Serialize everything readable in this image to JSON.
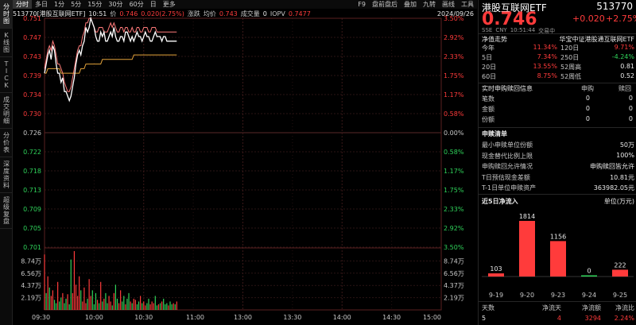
{
  "vtabs": [
    "分时图",
    "K线图",
    "TICK",
    "成交明细",
    "分价表",
    "深度资料",
    "超级复盘"
  ],
  "toolbar": {
    "left": [
      "分时",
      "多日",
      "1分",
      "5分",
      "15分",
      "30分",
      "60分",
      "日",
      "更多"
    ],
    "right": [
      "F9",
      "盘前盘后",
      "叠加",
      "九转",
      "画线",
      "工具"
    ]
  },
  "info": {
    "code_name": "513770[港股互联网ETF]",
    "time": "10:51",
    "price_label": "价",
    "price": "0.746",
    "chg_label": "涨跌",
    "chg": "0.020(2.75%)",
    "avg_label": "均价",
    "avg": "0.743",
    "vol_label": "成交量",
    "vol": "0",
    "iopv_label": "IOPV",
    "iopv": "0.7477",
    "date": "2024/09/26"
  },
  "chart_data": {
    "type": "line",
    "price_axis": [
      "0.751",
      "0.747",
      "0.743",
      "0.739",
      "0.734",
      "0.730",
      "0.726",
      "0.722",
      "0.718",
      "0.713",
      "0.709",
      "0.705",
      "0.701"
    ],
    "pct_axis": [
      "3.50%",
      "2.92%",
      "2.33%",
      "1.75%",
      "1.17%",
      "0.58%",
      "0.00%",
      "0.58%",
      "1.17%",
      "1.75%",
      "2.33%",
      "2.92%",
      "3.50%"
    ],
    "ylim": [
      0.701,
      0.751
    ],
    "prev_close": 0.726,
    "vol_axis": [
      "8.74万",
      "6.56万",
      "4.37万",
      "2.19万"
    ],
    "vol_axis_values": [
      87400,
      65600,
      43700,
      21900
    ],
    "vol_max": 109300,
    "time_axis": [
      "09:30",
      "10:00",
      "10:30",
      "11:00",
      "13:00",
      "13:30",
      "14:00",
      "14:30",
      "15:00"
    ],
    "price_series": [
      0.739,
      0.741,
      0.743,
      0.744,
      0.742,
      0.745,
      0.744,
      0.741,
      0.739,
      0.739,
      0.737,
      0.738,
      0.735,
      0.735,
      0.734,
      0.733,
      0.734,
      0.736,
      0.738,
      0.741,
      0.743,
      0.744,
      0.743,
      0.745,
      0.746,
      0.749,
      0.748,
      0.749,
      0.751,
      0.75,
      0.749,
      0.747,
      0.746,
      0.746,
      0.748,
      0.747,
      0.748,
      0.746,
      0.746,
      0.747,
      0.748,
      0.747,
      0.749,
      0.747,
      0.746,
      0.746,
      0.747,
      0.747,
      0.746,
      0.748,
      0.748,
      0.747,
      0.746,
      0.747,
      0.746,
      0.747,
      0.748,
      0.747,
      0.747,
      0.746,
      0.747,
      0.748,
      0.747,
      0.747,
      0.746,
      0.746,
      0.747,
      0.748,
      0.747,
      0.747,
      0.747,
      0.746,
      0.747,
      0.747,
      0.746,
      0.746,
      0.746,
      0.746,
      0.746,
      0.746,
      0.746
    ],
    "iopv_series": [
      0.74,
      0.742,
      0.744,
      0.745,
      0.744,
      0.746,
      0.745,
      0.743,
      0.741,
      0.741,
      0.74,
      0.739,
      0.737,
      0.736,
      0.735,
      0.735,
      0.736,
      0.738,
      0.74,
      0.742,
      0.744,
      0.745,
      0.745,
      0.747,
      0.748,
      0.75,
      0.75,
      0.751,
      0.751,
      0.75,
      0.749,
      0.748,
      0.748,
      0.749,
      0.749,
      0.749,
      0.748,
      0.748,
      0.748,
      0.749,
      0.75,
      0.749,
      0.75,
      0.749,
      0.748,
      0.748,
      0.749,
      0.749,
      0.748,
      0.749,
      0.749,
      0.748,
      0.748,
      0.749,
      0.748,
      0.748,
      0.749,
      0.749,
      0.748,
      0.748,
      0.749,
      0.749,
      0.749,
      0.748,
      0.748,
      0.749,
      0.749,
      0.749,
      0.748,
      0.748,
      0.748,
      0.748,
      0.748,
      0.748,
      0.748,
      0.748,
      0.748,
      0.748,
      0.748,
      0.748,
      0.748
    ],
    "avg_series": [
      0.739,
      0.739,
      0.74,
      0.74,
      0.74,
      0.74,
      0.74,
      0.74,
      0.74,
      0.74,
      0.739,
      0.739,
      0.739,
      0.739,
      0.739,
      0.739,
      0.739,
      0.739,
      0.739,
      0.739,
      0.739,
      0.739,
      0.74,
      0.74,
      0.74,
      0.741,
      0.741,
      0.741,
      0.741,
      0.741,
      0.741,
      0.741,
      0.741,
      0.741,
      0.741,
      0.742,
      0.742,
      0.742,
      0.742,
      0.742,
      0.742,
      0.742,
      0.742,
      0.742,
      0.742,
      0.742,
      0.742,
      0.742,
      0.742,
      0.742,
      0.742,
      0.742,
      0.742,
      0.742,
      0.743,
      0.743,
      0.743,
      0.743,
      0.743,
      0.743,
      0.743,
      0.743,
      0.743,
      0.743,
      0.743,
      0.743,
      0.743,
      0.743,
      0.743,
      0.743,
      0.743,
      0.743,
      0.743,
      0.743,
      0.743,
      0.743,
      0.743,
      0.743,
      0.743,
      0.743,
      0.743
    ],
    "volume": [
      99000,
      30000,
      60000,
      40000,
      25000,
      35000,
      18000,
      12000,
      50000,
      15000,
      22000,
      30000,
      12000,
      20000,
      28000,
      10000,
      90000,
      30000,
      105000,
      45000,
      25000,
      60000,
      35000,
      15000,
      40000,
      12000,
      20000,
      55000,
      25000,
      35000,
      10000,
      30000,
      18000,
      12000,
      50000,
      15000,
      20000,
      30000,
      12000,
      25000,
      15000,
      8000,
      30000,
      45000,
      20000,
      12000,
      35000,
      15000,
      25000,
      10000,
      20000,
      30000,
      15000,
      12000,
      20000,
      18000,
      10000,
      15000,
      25000,
      12000,
      15000,
      8000,
      12000,
      20000,
      10000,
      15000,
      12000,
      25000,
      8000,
      10000,
      12000,
      15000,
      20000,
      10000,
      12000,
      8000,
      15000,
      10000,
      12000,
      10000,
      15000
    ],
    "volume_up": [
      true,
      false,
      true,
      false,
      true,
      true,
      false,
      false,
      true,
      false,
      false,
      true,
      false,
      false,
      true,
      false,
      false,
      true,
      true,
      true,
      true,
      true,
      false,
      true,
      true,
      true,
      false,
      true,
      true,
      false,
      false,
      false,
      true,
      false,
      true,
      false,
      true,
      false,
      false,
      true,
      true,
      false,
      true,
      false,
      false,
      true,
      true,
      false,
      false,
      true,
      false,
      false,
      true,
      false,
      true,
      true,
      false,
      false,
      true,
      false,
      true,
      true,
      false,
      false,
      true,
      true,
      true,
      false,
      false,
      true,
      false,
      true,
      false,
      false,
      false,
      true,
      false,
      false,
      true,
      false,
      true
    ]
  },
  "panel": {
    "title": "港股互联网ETF",
    "code": "513770",
    "price": "0.746",
    "change": "+0.020",
    "change_pct": "+2.75%",
    "meta": [
      "SSE",
      "CNY",
      "10:51:44",
      "交易中"
    ],
    "nav_label": "净值走势",
    "index_name": "华宝中证港股通互联网ETF",
    "stats": [
      {
        "l1": "今年",
        "v1": "11.34%",
        "c1": "red",
        "l2": "120日",
        "v2": "9.71%",
        "c2": "red"
      },
      {
        "l1": "5日",
        "v1": "7.34%",
        "c1": "red",
        "l2": "250日",
        "v2": "-4.24%",
        "c2": "green"
      },
      {
        "l1": "20日",
        "v1": "13.55%",
        "c1": "red",
        "l2": "52周高",
        "v2": "0.81",
        "c2": "white"
      },
      {
        "l1": "60日",
        "v1": "8.75%",
        "c1": "red",
        "l2": "52周低",
        "v2": "0.52",
        "c2": "white"
      }
    ],
    "sub_title": "实时申购赎回信息",
    "sub_cols": [
      "申购",
      "赎回"
    ],
    "sub_rows": [
      {
        "label": "笔数",
        "buy": "0",
        "sell": "0"
      },
      {
        "label": "金额",
        "buy": "0",
        "sell": "0"
      },
      {
        "label": "份额",
        "buy": "0",
        "sell": "0"
      }
    ],
    "list_title": "申赎清单",
    "list_rows": [
      {
        "label": "最小申赎单位份额",
        "value": "50万"
      },
      {
        "label": "现金替代比例上限",
        "value": "100%"
      },
      {
        "label": "申购赎回允许情况",
        "value": "申购赎回皆允许"
      },
      {
        "label": "T日预估现金差额",
        "value": "10.81元"
      },
      {
        "label": "T-1日单位申赎资产",
        "value": "363982.05元"
      }
    ],
    "flow_title": "近5日净流入",
    "flow_unit": "单位(万元)",
    "flow": [
      {
        "date": "9-19",
        "value": 103
      },
      {
        "date": "9-20",
        "value": 1814
      },
      {
        "date": "9-23",
        "value": 1156
      },
      {
        "date": "9-24",
        "value": 0
      },
      {
        "date": "9-25",
        "value": 222
      }
    ],
    "foot_labels": [
      "天数",
      "净流天",
      "净流额",
      "净流比"
    ],
    "foot_values": [
      "5",
      "4",
      "3294",
      "2.24%"
    ],
    "colors": {
      "up": "#ff3b3b",
      "down": "#2fd35a",
      "avg": "#e2a23a",
      "iopv": "#ff7a7a"
    }
  }
}
